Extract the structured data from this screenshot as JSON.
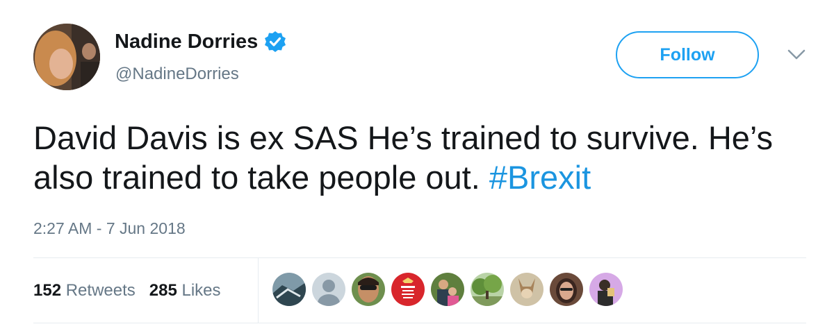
{
  "author": {
    "display_name": "Nadine Dorries",
    "handle": "@NadineDorries",
    "verified": true,
    "avatar_icon": "profile-photo"
  },
  "follow_button": {
    "label": "Follow"
  },
  "menu": {
    "icon": "chevron-down"
  },
  "tweet": {
    "text": "David Davis is ex SAS He’s trained to survive. He’s also trained to take people out. ",
    "hashtag": "#Brexit",
    "timestamp": "2:27 AM - 7 Jun 2018"
  },
  "stats": {
    "retweets_count": "152",
    "retweets_label": "Retweets",
    "likes_count": "285",
    "likes_label": "Likes"
  },
  "likers": [
    {
      "icon": "liker-avatar-1"
    },
    {
      "icon": "liker-avatar-default"
    },
    {
      "icon": "liker-avatar-3"
    },
    {
      "icon": "liker-avatar-4"
    },
    {
      "icon": "liker-avatar-5"
    },
    {
      "icon": "liker-avatar-6"
    },
    {
      "icon": "liker-avatar-7"
    },
    {
      "icon": "liker-avatar-8"
    },
    {
      "icon": "liker-avatar-9"
    }
  ],
  "colors": {
    "accent": "#1da1f2",
    "hashtag": "#1b95e0",
    "secondary_text": "#657786",
    "primary_text": "#14171a"
  }
}
